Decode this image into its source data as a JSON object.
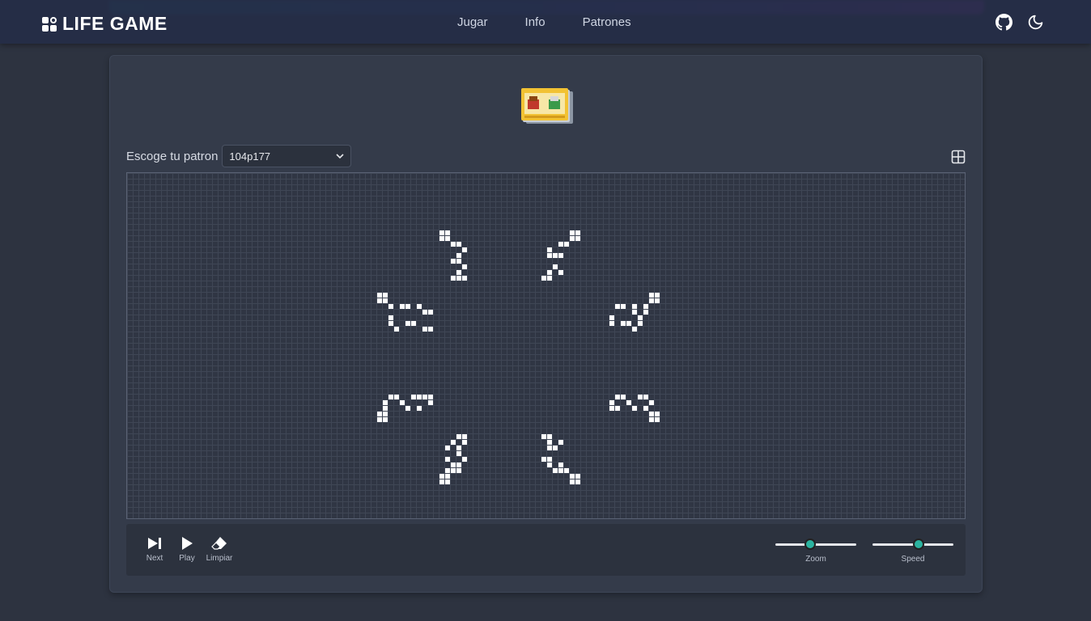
{
  "app": {
    "title": "LIFE GAME"
  },
  "nav": {
    "items": [
      {
        "label": "Jugar"
      },
      {
        "label": "Info"
      },
      {
        "label": "Patrones"
      }
    ]
  },
  "topbar_icons": [
    "github-icon",
    "moon-icon"
  ],
  "pattern": {
    "label": "Escoge tu patron",
    "selected": "104p177"
  },
  "controls": {
    "next_label": "Next",
    "play_label": "Play",
    "clear_label": "Limpiar",
    "zoom_label": "Zoom",
    "speed_label": "Speed",
    "zoom_value": 0.43,
    "speed_value": 0.57
  },
  "colors": {
    "accent": "#2bb3a0",
    "cell_alive": "#ffffff",
    "background": "#2d3340"
  },
  "board": {
    "alive_cells": [
      [
        55,
        10
      ],
      [
        56,
        10
      ],
      [
        55,
        11
      ],
      [
        56,
        11
      ],
      [
        57,
        12
      ],
      [
        58,
        12
      ],
      [
        59,
        13
      ],
      [
        58,
        14
      ],
      [
        57,
        15
      ],
      [
        58,
        15
      ],
      [
        59,
        16
      ],
      [
        58,
        17
      ],
      [
        57,
        18
      ],
      [
        58,
        18
      ],
      [
        59,
        18
      ],
      [
        78,
        10
      ],
      [
        79,
        10
      ],
      [
        78,
        11
      ],
      [
        79,
        11
      ],
      [
        76,
        12
      ],
      [
        77,
        12
      ],
      [
        74,
        13
      ],
      [
        74,
        14
      ],
      [
        75,
        14
      ],
      [
        76,
        14
      ],
      [
        75,
        16
      ],
      [
        74,
        17
      ],
      [
        76,
        17
      ],
      [
        73,
        18
      ],
      [
        74,
        18
      ],
      [
        44,
        21
      ],
      [
        45,
        21
      ],
      [
        44,
        22
      ],
      [
        45,
        22
      ],
      [
        46,
        23
      ],
      [
        48,
        23
      ],
      [
        49,
        23
      ],
      [
        51,
        23
      ],
      [
        52,
        24
      ],
      [
        53,
        24
      ],
      [
        46,
        25
      ],
      [
        46,
        26
      ],
      [
        49,
        26
      ],
      [
        50,
        26
      ],
      [
        47,
        27
      ],
      [
        52,
        27
      ],
      [
        53,
        27
      ],
      [
        92,
        21
      ],
      [
        93,
        21
      ],
      [
        92,
        22
      ],
      [
        93,
        22
      ],
      [
        91,
        23
      ],
      [
        86,
        23
      ],
      [
        87,
        23
      ],
      [
        89,
        23
      ],
      [
        89,
        24
      ],
      [
        91,
        24
      ],
      [
        85,
        25
      ],
      [
        90,
        25
      ],
      [
        85,
        26
      ],
      [
        87,
        26
      ],
      [
        88,
        26
      ],
      [
        90,
        26
      ],
      [
        89,
        27
      ],
      [
        46,
        39
      ],
      [
        47,
        39
      ],
      [
        50,
        39
      ],
      [
        51,
        39
      ],
      [
        52,
        39
      ],
      [
        53,
        39
      ],
      [
        45,
        40
      ],
      [
        48,
        40
      ],
      [
        53,
        40
      ],
      [
        45,
        41
      ],
      [
        49,
        41
      ],
      [
        51,
        41
      ],
      [
        44,
        42
      ],
      [
        45,
        42
      ],
      [
        44,
        43
      ],
      [
        45,
        43
      ],
      [
        86,
        39
      ],
      [
        87,
        39
      ],
      [
        90,
        39
      ],
      [
        91,
        39
      ],
      [
        85,
        40
      ],
      [
        88,
        40
      ],
      [
        92,
        40
      ],
      [
        85,
        41
      ],
      [
        86,
        41
      ],
      [
        89,
        41
      ],
      [
        91,
        41
      ],
      [
        92,
        42
      ],
      [
        93,
        42
      ],
      [
        92,
        43
      ],
      [
        93,
        43
      ],
      [
        58,
        46
      ],
      [
        59,
        46
      ],
      [
        57,
        47
      ],
      [
        59,
        47
      ],
      [
        56,
        48
      ],
      [
        58,
        48
      ],
      [
        58,
        49
      ],
      [
        56,
        50
      ],
      [
        59,
        50
      ],
      [
        57,
        51
      ],
      [
        58,
        51
      ],
      [
        56,
        52
      ],
      [
        57,
        52
      ],
      [
        58,
        52
      ],
      [
        55,
        53
      ],
      [
        56,
        53
      ],
      [
        55,
        54
      ],
      [
        56,
        54
      ],
      [
        73,
        46
      ],
      [
        74,
        46
      ],
      [
        74,
        47
      ],
      [
        76,
        47
      ],
      [
        74,
        48
      ],
      [
        75,
        48
      ],
      [
        73,
        50
      ],
      [
        74,
        50
      ],
      [
        74,
        51
      ],
      [
        76,
        51
      ],
      [
        75,
        52
      ],
      [
        76,
        52
      ],
      [
        77,
        52
      ],
      [
        78,
        53
      ],
      [
        79,
        53
      ],
      [
        78,
        54
      ],
      [
        79,
        54
      ]
    ]
  }
}
